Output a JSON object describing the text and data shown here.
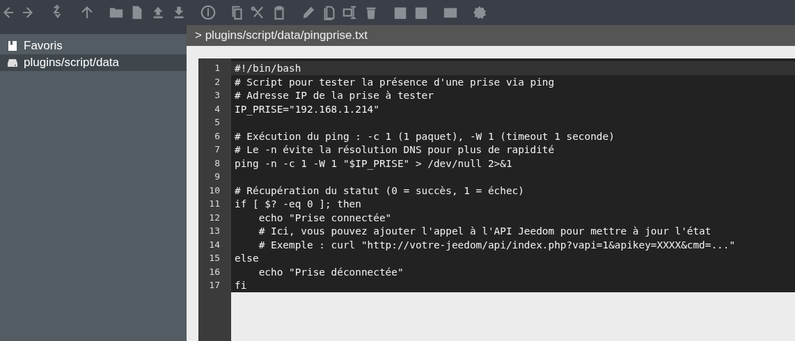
{
  "sidebar": {
    "items": [
      {
        "label": "Favoris",
        "kind": "bookmark",
        "selected": false
      },
      {
        "label": "plugins/script/data",
        "kind": "drive",
        "selected": true
      }
    ]
  },
  "editor": {
    "path": "> plugins/script/data/pingprise.txt",
    "lines": [
      {
        "number": "1",
        "text": "#!/bin/bash",
        "current": true
      },
      {
        "number": "2",
        "text": "# Script pour tester la présence d'une prise via ping",
        "current": false
      },
      {
        "number": "3",
        "text": "# Adresse IP de la prise à tester",
        "current": false
      },
      {
        "number": "4",
        "text": "IP_PRISE=\"192.168.1.214\"",
        "current": false
      },
      {
        "number": "5",
        "current": false
      },
      {
        "number": "6",
        "text": "# Exécution du ping : -c 1 (1 paquet), -W 1 (timeout 1 seconde)",
        "current": false
      },
      {
        "number": "7",
        "text": "# Le -n évite la résolution DNS pour plus de rapidité",
        "current": false
      },
      {
        "number": "8",
        "text": "ping -n -c 1 -W 1 \"$IP_PRISE\" > /dev/null 2>&1",
        "current": false
      },
      {
        "number": "9",
        "current": false
      },
      {
        "number": "10",
        "text": "# Récupération du statut (0 = succès, 1 = échec)",
        "current": false
      },
      {
        "number": "11",
        "text": "if [ $? -eq 0 ]; then",
        "current": false
      },
      {
        "number": "12",
        "text": "    echo \"Prise connectée\"",
        "current": false
      },
      {
        "number": "13",
        "text": "    # Ici, vous pouvez ajouter l'appel à l'API Jeedom pour mettre à jour l'état",
        "current": false
      },
      {
        "number": "14",
        "text": "    # Exemple : curl \"http://votre-jeedom/api/index.php?vapi=1&apikey=XXXX&cmd=...\"",
        "current": false
      },
      {
        "number": "15",
        "text": "else",
        "current": false
      },
      {
        "number": "16",
        "text": "    echo \"Prise déconnectée\"",
        "current": false
      },
      {
        "number": "17",
        "text": "fi",
        "current": false
      }
    ]
  }
}
